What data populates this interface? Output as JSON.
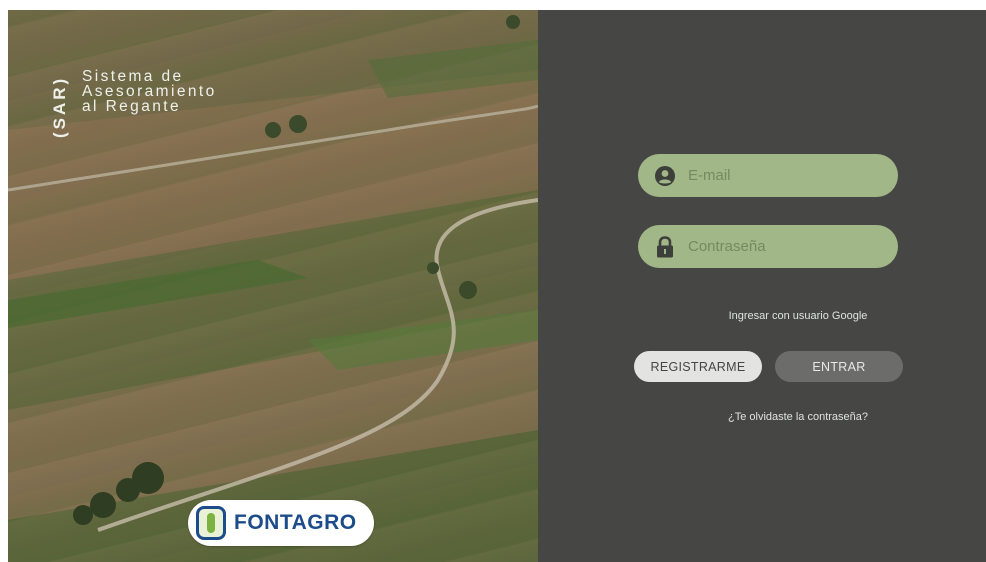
{
  "brand": {
    "acronym": "(SAR)",
    "title_lines": [
      "Sistema de",
      "Asesoramiento",
      "al Regante"
    ]
  },
  "logo": {
    "name": "FONTAGRO",
    "icon": "fontagro-wheat-logo-icon"
  },
  "login": {
    "email": {
      "placeholder": "E-mail",
      "value": "",
      "icon": "user-circle-icon"
    },
    "password": {
      "placeholder": "Contraseña",
      "value": "",
      "icon": "lock-icon"
    },
    "google_link": "Ingresar con usuario Google",
    "register_label": "REGISTRARME",
    "enter_label": "ENTRAR",
    "forgot_link": "¿Te olvidaste la contraseña?"
  },
  "colors": {
    "panel_bg": "#464745",
    "field_bg": "#a2b788",
    "register_bg": "#e3e3e1",
    "enter_bg": "#6c6d6b",
    "logo_blue": "#1c4d8a",
    "logo_green": "#7cb240"
  }
}
